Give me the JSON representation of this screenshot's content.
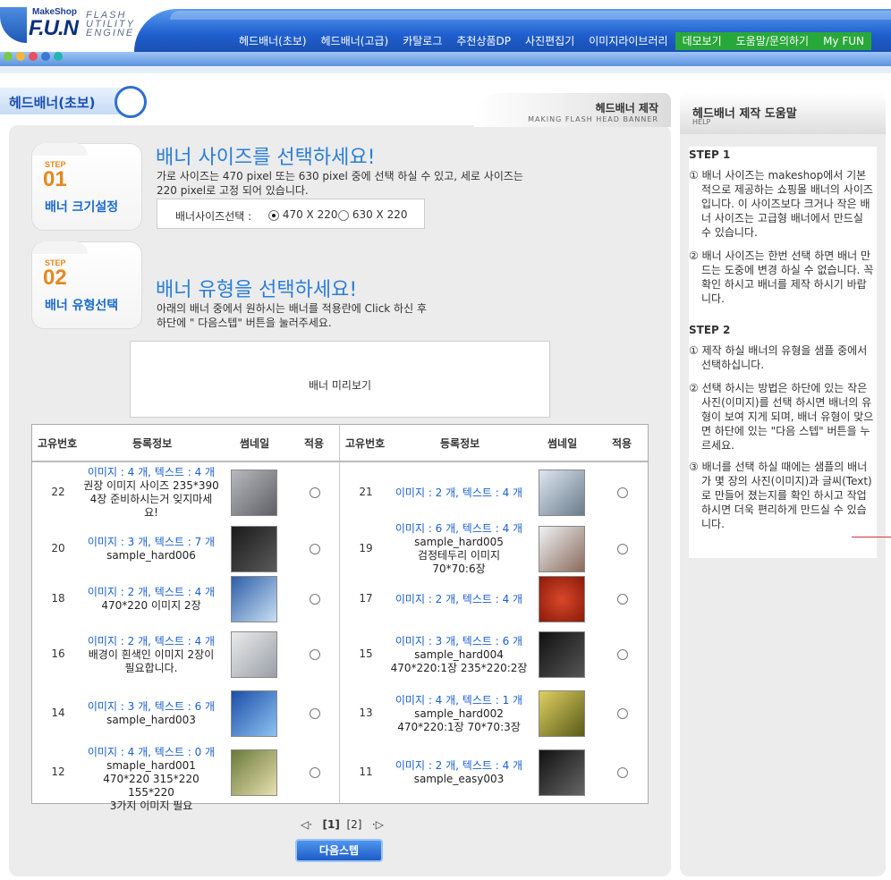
{
  "brand": {
    "make": "MakeShop",
    "fun": "F.U.N",
    "flash": "FLASH UTILITY ENGINE"
  },
  "nav": [
    "헤드배너(초보)",
    "헤드배너(고급)",
    "카탈로그",
    "추천상품DP",
    "사진편집기",
    "이미지라이브러리",
    "데모보기",
    "도움말/문의하기",
    "My FUN"
  ],
  "colors": {
    "accent": "#2a7ed8",
    "brand_blue": "#1f5fcf",
    "step_orange": "#e8871e",
    "nav_green": "#29a83a"
  },
  "panel": {
    "tab_title": "헤드배너(초보)",
    "section_title": "헤드배너 제작",
    "section_sub": "MAKING FLASH HEAD BANNER"
  },
  "step1": {
    "label": "STEP",
    "num": "01",
    "name": "배너 크기설정",
    "title": "배너 사이즈를 선택하세요!",
    "desc1": "가로 사이즈는 470 pixel 또는 630 pixel 중에 선택 하실 수 있고, 세로 사이즈는",
    "desc2": "220 pixel로 고정 되어 있습니다.",
    "select_label": "배너사이즈선택 :",
    "options": [
      "470 X 220",
      "630 X 220"
    ],
    "selected": "470 X 220"
  },
  "step2": {
    "label": "STEP",
    "num": "02",
    "name": "배너 유형선택",
    "title": "배너 유형을 선택하세요!",
    "desc1": "아래의 배너 중에서 원하시는 배너를 적용란에 Click 하신 후",
    "desc2": "하단에 \" 다음스텝\" 버튼을 눌러주세요."
  },
  "preview_label": "배너 미리보기",
  "table": {
    "headers": [
      "고유번호",
      "등록정보",
      "썸네일",
      "적용"
    ],
    "rows": [
      {
        "left": {
          "id": "22",
          "info": "이미지 : 4 개, 텍스트 : 4 개",
          "desc": [
            "권장 이미지 사이즈 235*390",
            "4장 준비하시는거 잊지마세",
            "요!"
          ]
        },
        "right": {
          "id": "21",
          "info": "이미지 : 2 개, 텍스트 : 4 개",
          "desc": []
        }
      },
      {
        "left": {
          "id": "20",
          "info": "이미지 : 3 개, 텍스트 : 7 개",
          "desc": [
            "sample_hard006"
          ]
        },
        "right": {
          "id": "19",
          "info": "이미지 : 6 개, 텍스트 : 4 개",
          "desc": [
            "sample_hard005",
            "검정테두리 이미지",
            "70*70:6장"
          ]
        }
      },
      {
        "left": {
          "id": "18",
          "info": "이미지 : 2 개, 텍스트 : 4 개",
          "desc": [
            "470*220 이미지 2장"
          ]
        },
        "right": {
          "id": "17",
          "info": "이미지 : 2 개, 텍스트 : 4 개",
          "desc": []
        }
      },
      {
        "left": {
          "id": "16",
          "info": "이미지 : 2 개, 텍스트 : 4 개",
          "desc": [
            "배경이 흰색인 이미지 2장이",
            "필요합니다."
          ]
        },
        "right": {
          "id": "15",
          "info": "이미지 : 3 개, 텍스트 : 6 개",
          "desc": [
            "sample_hard004",
            "470*220:1장 235*220:2장"
          ]
        }
      },
      {
        "left": {
          "id": "14",
          "info": "이미지 : 3 개, 텍스트 : 6 개",
          "desc": [
            "sample_hard003"
          ]
        },
        "right": {
          "id": "13",
          "info": "이미지 : 4 개, 텍스트 : 1 개",
          "desc": [
            "sample_hard002",
            "470*220:1장 70*70:3장"
          ]
        }
      },
      {
        "left": {
          "id": "12",
          "info": "이미지 : 4 개, 텍스트 : 0 개",
          "desc": [
            "smaple_hard001",
            "470*220 315*220 155*220",
            "3가지 이미지 필요"
          ]
        },
        "right": {
          "id": "11",
          "info": "이미지 : 2 개, 텍스트 : 4 개",
          "desc": [
            "sample_easy003"
          ]
        }
      }
    ]
  },
  "pager": {
    "prev": "◁·",
    "pages": [
      "[1]",
      "[2]"
    ],
    "next": "·▷"
  },
  "next_button": "다음스텝",
  "help": {
    "title": "헤드배너 제작 도움말",
    "sub": "HELP",
    "step1_title": "STEP 1",
    "step1_items": [
      "① 배너 사이즈는 makeshop에서 기본적으로 제공하는 쇼핑몰 배너의 사이즈 입니다. 이 사이즈보다 크거나 작은 배너 사이즈는 고급형 배너에서 만드실 수 있습니다.",
      "② 배너 사이즈는 한번 선택 하면 배너 만드는 도중에 변경 하실 수 없습니다. 꼭 확인 하시고 배너를 제작 하시기 바랍니다."
    ],
    "step2_title": "STEP 2",
    "step2_items": [
      "① 제작 하실 배너의 유형을 샘플 중에서 선택하십니다.",
      "② 선택 하시는 방법은 하단에 있는 작은 사진(이미지)를 선택 하시면 배너의 유형이 보여 지게 되며, 배너 유형이 맞으면 하단에 있는 \"다음 스텝\" 버튼을 누르세요.",
      "③ 배너를 선택 하실 때에는 샘플의 배너가 몇 장의 사진(이미지)과 글씨(Text)로 만들어 졌는지를 확인 하시고 작업 하시면 더욱 편리하게 만드실 수 있습니다."
    ]
  }
}
